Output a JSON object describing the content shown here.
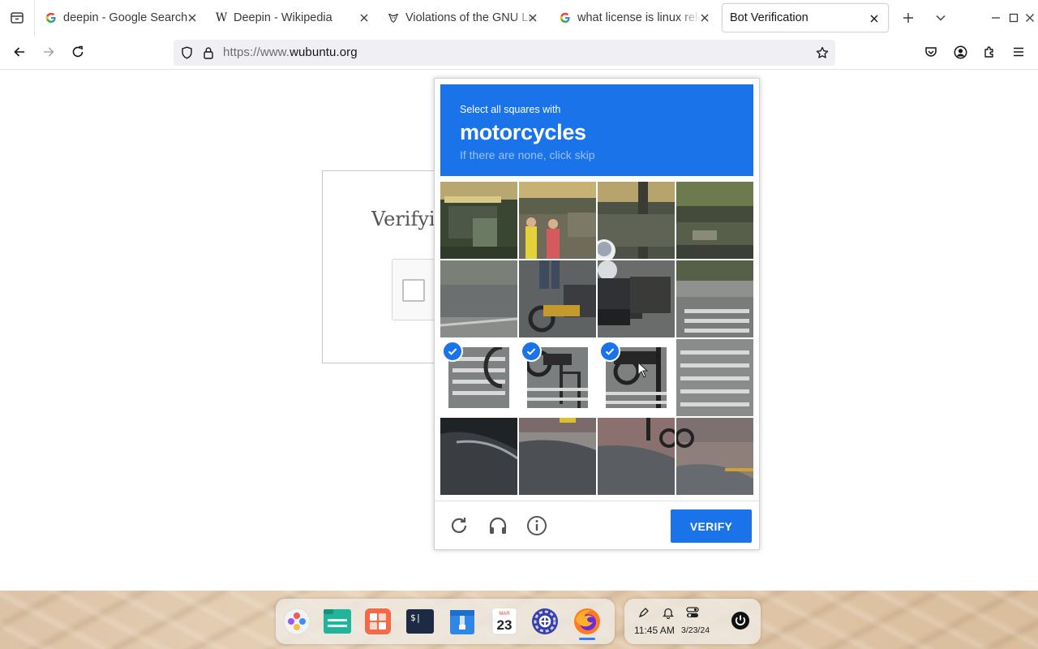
{
  "browser": {
    "tabs": [
      {
        "title": "deepin - Google Search",
        "favicon": "google-icon",
        "active": false
      },
      {
        "title": "Deepin - Wikipedia",
        "favicon": "wikipedia-icon",
        "active": false
      },
      {
        "title": "Violations of the GNU Licenses",
        "favicon": "gnu-icon",
        "active": false
      },
      {
        "title": "what license is linux released under",
        "favicon": "google-icon",
        "active": false
      },
      {
        "title": "Bot Verification",
        "favicon": "",
        "active": true
      }
    ],
    "url": {
      "scheme": "https://www.",
      "host": "wubuntu.org"
    },
    "colors": {
      "accent": "#1a73e8"
    }
  },
  "page": {
    "heading": "Verifying"
  },
  "captcha": {
    "instruction": "Select all squares with",
    "target": "motorcycles",
    "hint": "If there are none, click skip",
    "verify_label": "VERIFY",
    "grid": {
      "rows": 4,
      "cols": 4,
      "selected": [
        8,
        9,
        10
      ]
    },
    "footer_icons": [
      "reload-icon",
      "audio-icon",
      "info-icon"
    ]
  },
  "taskbar": {
    "dock_apps": [
      "launcher-icon",
      "file-manager-icon",
      "app-store-icon",
      "terminal-icon",
      "archive-icon",
      "calendar-icon",
      "settings-icon",
      "firefox-icon"
    ],
    "calendar": {
      "month": "MAR",
      "day": "23"
    },
    "clock": {
      "time": "11:45 AM",
      "date": "3/23/24"
    }
  }
}
